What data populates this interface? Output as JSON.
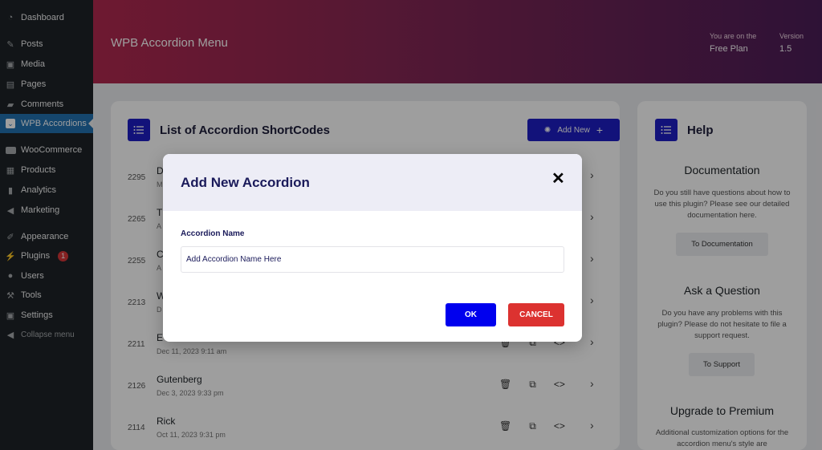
{
  "sidebar": {
    "items": [
      {
        "label": "Dashboard",
        "icon": "dashboard-icon"
      },
      {
        "label": "Posts",
        "icon": "pin-icon"
      },
      {
        "label": "Media",
        "icon": "media-icon"
      },
      {
        "label": "Pages",
        "icon": "pages-icon"
      },
      {
        "label": "Comments",
        "icon": "comment-icon"
      },
      {
        "label": "WPB Accordions",
        "icon": "accordion-icon",
        "active": true
      },
      {
        "label": "WooCommerce",
        "icon": "woo-icon"
      },
      {
        "label": "Products",
        "icon": "products-icon"
      },
      {
        "label": "Analytics",
        "icon": "analytics-icon"
      },
      {
        "label": "Marketing",
        "icon": "megaphone-icon"
      },
      {
        "label": "Appearance",
        "icon": "brush-icon"
      },
      {
        "label": "Plugins",
        "icon": "plug-icon",
        "badge": "1"
      },
      {
        "label": "Users",
        "icon": "user-icon"
      },
      {
        "label": "Tools",
        "icon": "wrench-icon"
      },
      {
        "label": "Settings",
        "icon": "settings-icon"
      },
      {
        "label": "Collapse menu",
        "icon": "collapse-icon"
      }
    ]
  },
  "header": {
    "title": "WPB Accordion Menu",
    "plan_label": "You are on the",
    "plan_value": "Free Plan",
    "version_label": "Version",
    "version_value": "1.5",
    "gradient": [
      "#b2294f",
      "#4b1d57"
    ]
  },
  "list": {
    "title": "List of Accordion ShortCodes",
    "add_new_label": "Add New",
    "rows": [
      {
        "id": "2295",
        "name": "D",
        "date": "M"
      },
      {
        "id": "2265",
        "name": "T",
        "date": "A"
      },
      {
        "id": "2255",
        "name": "C",
        "date": "A"
      },
      {
        "id": "2213",
        "name": "W",
        "date": "D"
      },
      {
        "id": "2211",
        "name": "E",
        "date": "Dec 11, 2023 9:11 am"
      },
      {
        "id": "2126",
        "name": "Gutenberg",
        "date": "Dec 3, 2023 9:33 pm"
      },
      {
        "id": "2114",
        "name": "Rick",
        "date": "Oct 11, 2023 9:31 pm"
      }
    ]
  },
  "help": {
    "title": "Help",
    "doc_title": "Documentation",
    "doc_text": "Do you still have questions about how to use this plugin? Please see our detailed documentation here.",
    "doc_button": "To Documentation",
    "ask_title": "Ask a Question",
    "ask_text": "Do you have any problems with this plugin? Please do not hesitate to file a support request.",
    "ask_button": "To Support",
    "premium_title": "Upgrade to Premium",
    "premium_text": "Additional customization options for the accordion menu's style are"
  },
  "modal": {
    "title": "Add New Accordion",
    "field_label": "Accordion Name",
    "field_placeholder": "Add Accordion Name Here",
    "ok_label": "OK",
    "cancel_label": "CANCEL"
  },
  "colors": {
    "accent": "#1e1ec5",
    "ok": "#0000ee",
    "cancel": "#dc3230",
    "wp_active": "#2271b1"
  }
}
